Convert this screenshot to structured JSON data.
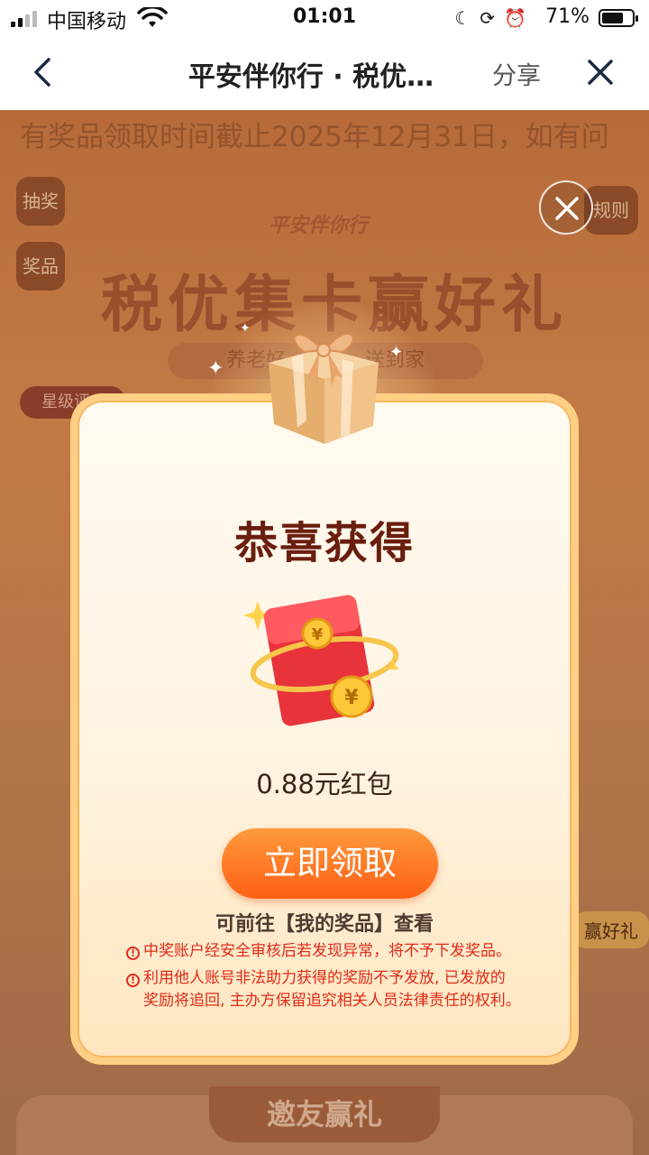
{
  "status_bar": {
    "carrier": "中国移动",
    "time": "01:01",
    "battery_pct": "71%",
    "battery_level": 0.71
  },
  "nav": {
    "title": "平安伴你行 · 税优…",
    "share_label": "分享"
  },
  "background": {
    "marquee": "有奖品领取时间截止2025年12月31日，如有问",
    "tab_lottery": "抽奖",
    "tab_prize": "奖品",
    "tab_rules": "规则",
    "logo": "平安伴你行",
    "hero_title": "税优集卡赢好礼",
    "slogan": "养老好　　　　送到家",
    "star_badge": "星级评",
    "gift_label": "赢好礼",
    "invite_title": "邀友赢礼"
  },
  "modal": {
    "heading": "恭喜获得",
    "prize_name": "0.88元红包",
    "claim_label": "立即领取",
    "hint": "可前往【我的奖品】查看",
    "warning_1": "中奖账户经安全审核后若发现异常，将不予下发奖品。",
    "warning_2_line1": "利用他人账号非法助力获得的奖励不予发放, 已发放的",
    "warning_2_line2": "奖励将追回, 主办方保留追究相关人员法律责任的权利。"
  },
  "colors": {
    "accent": "#ff6a1a",
    "heading": "#6a1e0e",
    "warning": "#e02a1a",
    "card_border": "#ffcf85"
  }
}
